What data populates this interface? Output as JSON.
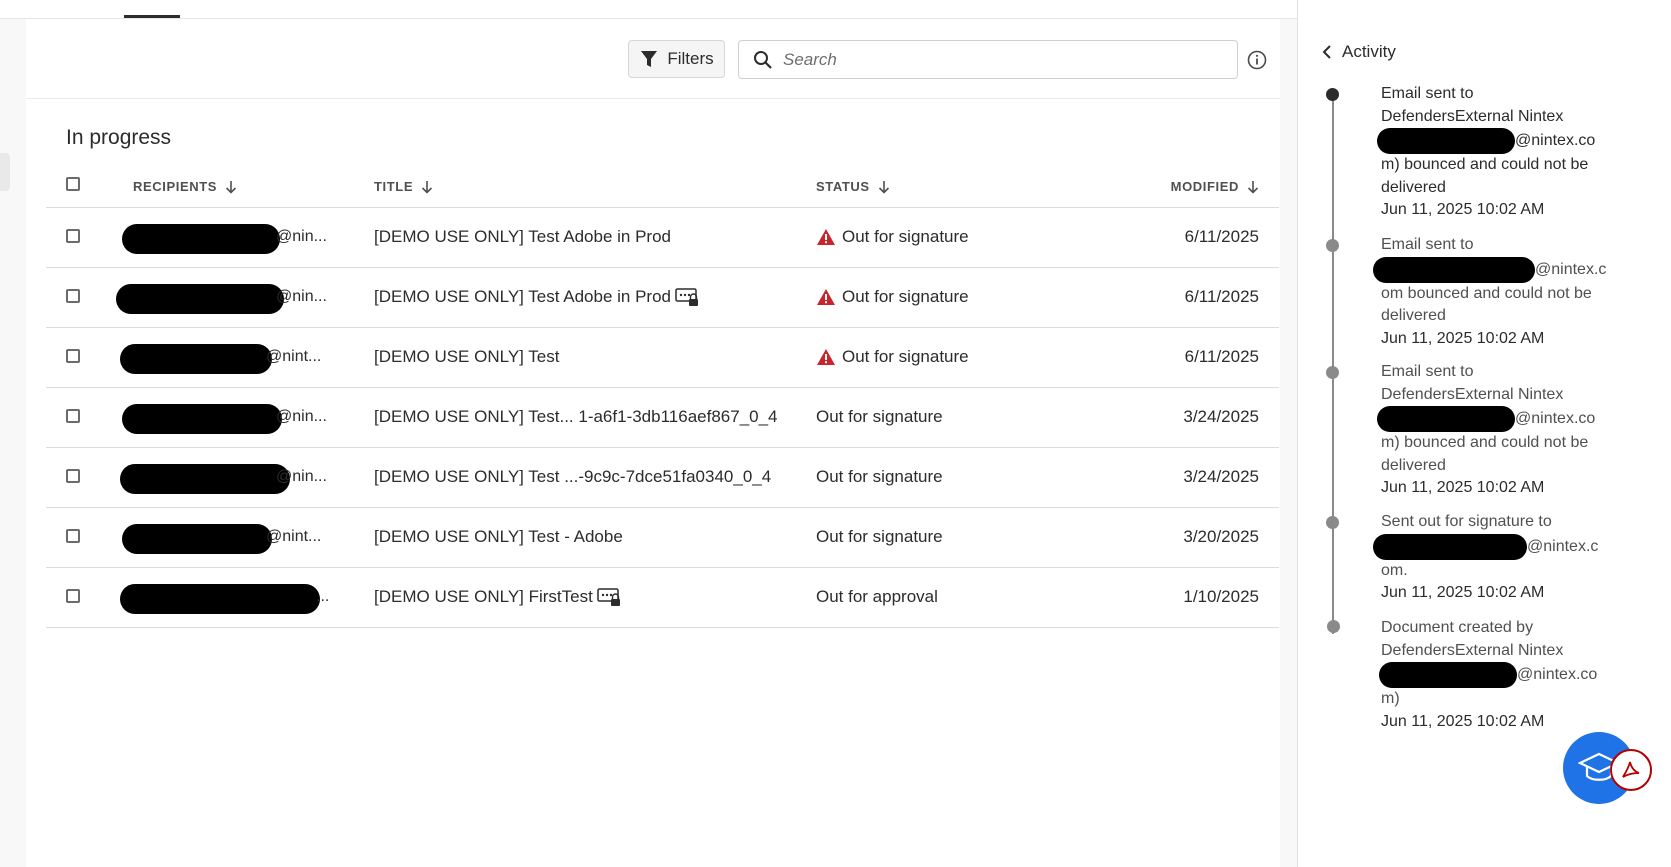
{
  "toolbar": {
    "filters_label": "Filters",
    "search_placeholder": "Search"
  },
  "section_title": "In progress",
  "table": {
    "columns": [
      {
        "label": "RECIPIENTS"
      },
      {
        "label": "TITLE"
      },
      {
        "label": "STATUS"
      },
      {
        "label": "MODIFIED"
      }
    ],
    "rows": [
      {
        "recipient_suffix": "@nin...",
        "title": "[DEMO USE ONLY] Test Adobe in Prod",
        "status": "Out for signature",
        "modified": "6/11/2025"
      },
      {
        "recipient_suffix": "@nin...",
        "title": "[DEMO USE ONLY] Test Adobe in Prod",
        "status": "Out for signature",
        "modified": "6/11/2025"
      },
      {
        "recipient_suffix": "@nint...",
        "title": "[DEMO USE ONLY] Test",
        "status": "Out for signature",
        "modified": "6/11/2025"
      },
      {
        "recipient_suffix": "@nin...",
        "title": "[DEMO USE ONLY] Test... 1-a6f1-3db116aef867_0_4",
        "status": "Out for signature",
        "modified": "3/24/2025"
      },
      {
        "recipient_suffix": "@nin...",
        "title": "[DEMO USE ONLY] Test ...-9c9c-7dce51fa0340_0_4",
        "status": "Out for signature",
        "modified": "3/24/2025"
      },
      {
        "recipient_suffix": "@nint...",
        "title": "[DEMO USE ONLY] Test - Adobe",
        "status": "Out for signature",
        "modified": "3/20/2025"
      },
      {
        "recipient_suffix": "...",
        "title": "[DEMO USE ONLY] FirstTest",
        "status": "Out for approval",
        "modified": "1/10/2025"
      }
    ]
  },
  "activity": {
    "title": "Activity",
    "items": [
      {
        "line1": "Email sent to",
        "line2": "DefendersExternal Nintex",
        "after_redact": "@nintex.co",
        "line4": "m) bounced and could not be",
        "line5": "delivered",
        "time": "Jun 11, 2025 10:02 AM"
      },
      {
        "line1": "Email sent to",
        "after_redact": "@nintex.c",
        "line3": "om bounced and could not be",
        "line4": "delivered",
        "time": "Jun 11, 2025 10:02 AM"
      },
      {
        "line1": "Email sent to",
        "line2": "DefendersExternal Nintex",
        "after_redact": "@nintex.co",
        "line4": "m) bounced and could not be",
        "line5": "delivered",
        "time": "Jun 11, 2025 10:02 AM"
      },
      {
        "line1": "Sent out for signature to",
        "after_redact": "@nintex.c",
        "line3": "om.",
        "time": "Jun 11, 2025 10:02 AM"
      },
      {
        "line1": "Document created by",
        "line2": "DefendersExternal Nintex",
        "after_redact": "@nintex.co",
        "line4": "m)",
        "time": "Jun 11, 2025 10:02 AM"
      }
    ]
  },
  "colors": {
    "accent_blue": "#1f73e6",
    "warning_red": "#c9252d",
    "adobe_red": "#b40000"
  }
}
